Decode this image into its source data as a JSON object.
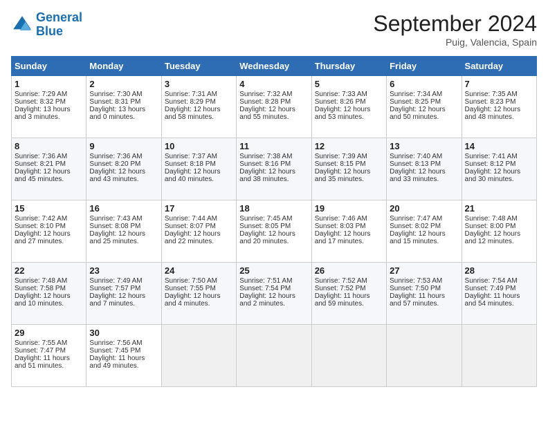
{
  "header": {
    "logo_line1": "General",
    "logo_line2": "Blue",
    "month": "September 2024",
    "location": "Puig, Valencia, Spain"
  },
  "weekdays": [
    "Sunday",
    "Monday",
    "Tuesday",
    "Wednesday",
    "Thursday",
    "Friday",
    "Saturday"
  ],
  "weeks": [
    [
      {
        "day": "1",
        "sunrise": "Sunrise: 7:29 AM",
        "sunset": "Sunset: 8:32 PM",
        "daylight": "Daylight: 13 hours and 3 minutes."
      },
      {
        "day": "2",
        "sunrise": "Sunrise: 7:30 AM",
        "sunset": "Sunset: 8:31 PM",
        "daylight": "Daylight: 13 hours and 0 minutes."
      },
      {
        "day": "3",
        "sunrise": "Sunrise: 7:31 AM",
        "sunset": "Sunset: 8:29 PM",
        "daylight": "Daylight: 12 hours and 58 minutes."
      },
      {
        "day": "4",
        "sunrise": "Sunrise: 7:32 AM",
        "sunset": "Sunset: 8:28 PM",
        "daylight": "Daylight: 12 hours and 55 minutes."
      },
      {
        "day": "5",
        "sunrise": "Sunrise: 7:33 AM",
        "sunset": "Sunset: 8:26 PM",
        "daylight": "Daylight: 12 hours and 53 minutes."
      },
      {
        "day": "6",
        "sunrise": "Sunrise: 7:34 AM",
        "sunset": "Sunset: 8:25 PM",
        "daylight": "Daylight: 12 hours and 50 minutes."
      },
      {
        "day": "7",
        "sunrise": "Sunrise: 7:35 AM",
        "sunset": "Sunset: 8:23 PM",
        "daylight": "Daylight: 12 hours and 48 minutes."
      }
    ],
    [
      {
        "day": "8",
        "sunrise": "Sunrise: 7:36 AM",
        "sunset": "Sunset: 8:21 PM",
        "daylight": "Daylight: 12 hours and 45 minutes."
      },
      {
        "day": "9",
        "sunrise": "Sunrise: 7:36 AM",
        "sunset": "Sunset: 8:20 PM",
        "daylight": "Daylight: 12 hours and 43 minutes."
      },
      {
        "day": "10",
        "sunrise": "Sunrise: 7:37 AM",
        "sunset": "Sunset: 8:18 PM",
        "daylight": "Daylight: 12 hours and 40 minutes."
      },
      {
        "day": "11",
        "sunrise": "Sunrise: 7:38 AM",
        "sunset": "Sunset: 8:16 PM",
        "daylight": "Daylight: 12 hours and 38 minutes."
      },
      {
        "day": "12",
        "sunrise": "Sunrise: 7:39 AM",
        "sunset": "Sunset: 8:15 PM",
        "daylight": "Daylight: 12 hours and 35 minutes."
      },
      {
        "day": "13",
        "sunrise": "Sunrise: 7:40 AM",
        "sunset": "Sunset: 8:13 PM",
        "daylight": "Daylight: 12 hours and 33 minutes."
      },
      {
        "day": "14",
        "sunrise": "Sunrise: 7:41 AM",
        "sunset": "Sunset: 8:12 PM",
        "daylight": "Daylight: 12 hours and 30 minutes."
      }
    ],
    [
      {
        "day": "15",
        "sunrise": "Sunrise: 7:42 AM",
        "sunset": "Sunset: 8:10 PM",
        "daylight": "Daylight: 12 hours and 27 minutes."
      },
      {
        "day": "16",
        "sunrise": "Sunrise: 7:43 AM",
        "sunset": "Sunset: 8:08 PM",
        "daylight": "Daylight: 12 hours and 25 minutes."
      },
      {
        "day": "17",
        "sunrise": "Sunrise: 7:44 AM",
        "sunset": "Sunset: 8:07 PM",
        "daylight": "Daylight: 12 hours and 22 minutes."
      },
      {
        "day": "18",
        "sunrise": "Sunrise: 7:45 AM",
        "sunset": "Sunset: 8:05 PM",
        "daylight": "Daylight: 12 hours and 20 minutes."
      },
      {
        "day": "19",
        "sunrise": "Sunrise: 7:46 AM",
        "sunset": "Sunset: 8:03 PM",
        "daylight": "Daylight: 12 hours and 17 minutes."
      },
      {
        "day": "20",
        "sunrise": "Sunrise: 7:47 AM",
        "sunset": "Sunset: 8:02 PM",
        "daylight": "Daylight: 12 hours and 15 minutes."
      },
      {
        "day": "21",
        "sunrise": "Sunrise: 7:48 AM",
        "sunset": "Sunset: 8:00 PM",
        "daylight": "Daylight: 12 hours and 12 minutes."
      }
    ],
    [
      {
        "day": "22",
        "sunrise": "Sunrise: 7:48 AM",
        "sunset": "Sunset: 7:58 PM",
        "daylight": "Daylight: 12 hours and 10 minutes."
      },
      {
        "day": "23",
        "sunrise": "Sunrise: 7:49 AM",
        "sunset": "Sunset: 7:57 PM",
        "daylight": "Daylight: 12 hours and 7 minutes."
      },
      {
        "day": "24",
        "sunrise": "Sunrise: 7:50 AM",
        "sunset": "Sunset: 7:55 PM",
        "daylight": "Daylight: 12 hours and 4 minutes."
      },
      {
        "day": "25",
        "sunrise": "Sunrise: 7:51 AM",
        "sunset": "Sunset: 7:54 PM",
        "daylight": "Daylight: 12 hours and 2 minutes."
      },
      {
        "day": "26",
        "sunrise": "Sunrise: 7:52 AM",
        "sunset": "Sunset: 7:52 PM",
        "daylight": "Daylight: 11 hours and 59 minutes."
      },
      {
        "day": "27",
        "sunrise": "Sunrise: 7:53 AM",
        "sunset": "Sunset: 7:50 PM",
        "daylight": "Daylight: 11 hours and 57 minutes."
      },
      {
        "day": "28",
        "sunrise": "Sunrise: 7:54 AM",
        "sunset": "Sunset: 7:49 PM",
        "daylight": "Daylight: 11 hours and 54 minutes."
      }
    ],
    [
      {
        "day": "29",
        "sunrise": "Sunrise: 7:55 AM",
        "sunset": "Sunset: 7:47 PM",
        "daylight": "Daylight: 11 hours and 51 minutes."
      },
      {
        "day": "30",
        "sunrise": "Sunrise: 7:56 AM",
        "sunset": "Sunset: 7:45 PM",
        "daylight": "Daylight: 11 hours and 49 minutes."
      },
      null,
      null,
      null,
      null,
      null
    ]
  ]
}
